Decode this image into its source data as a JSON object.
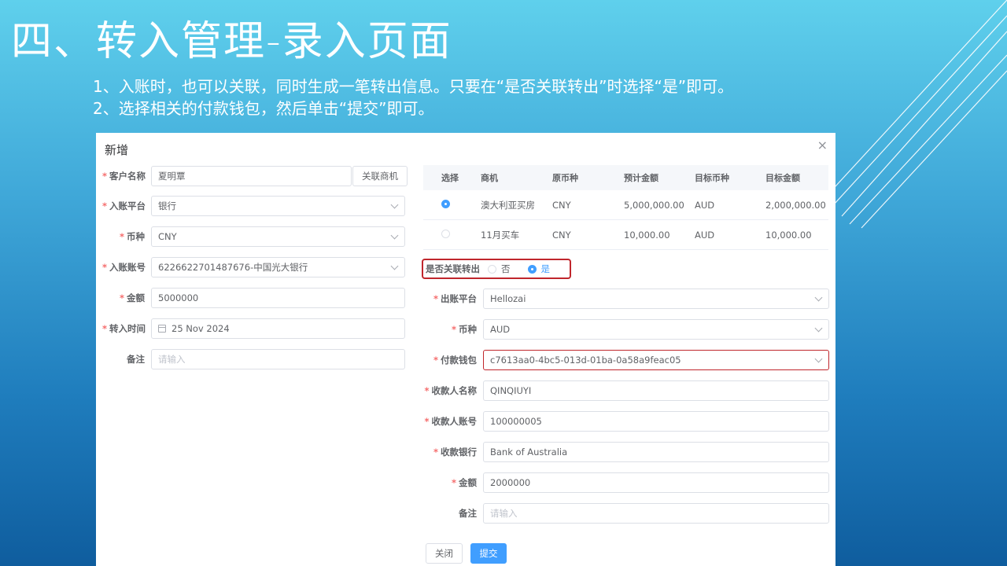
{
  "slide": {
    "title": "四、转入管理-录入页面",
    "bullets": [
      "1、入账时，也可以关联，同时生成一笔转出信息。只要在“是否关联转出”时选择“是”即可。",
      "2、选择相关的付款钱包，然后单击“提交”即可。"
    ]
  },
  "dialog": {
    "title": "新增",
    "close_icon": "×",
    "left_form": {
      "customer": {
        "label": "客户名称",
        "value": "夏明覃",
        "link_button": "关联商机"
      },
      "platform": {
        "label": "入账平台",
        "value": "银行"
      },
      "currency": {
        "label": "币种",
        "value": "CNY"
      },
      "account": {
        "label": "入账账号",
        "value": "6226622701487676-中国光大银行"
      },
      "amount": {
        "label": "金额",
        "value": "5000000"
      },
      "time": {
        "label": "转入时间",
        "value": "25 Nov 2024"
      },
      "remark": {
        "label": "备注",
        "placeholder": "请输入"
      }
    },
    "table": {
      "headers": [
        "选择",
        "商机",
        "原币种",
        "预计金额",
        "目标币种",
        "目标金额"
      ],
      "rows": [
        {
          "selected": true,
          "opportunity": "澳大利亚买房",
          "src_currency": "CNY",
          "est_amount": "5,000,000.00",
          "target_currency": "AUD",
          "target_amount": "2,000,000.00"
        },
        {
          "selected": false,
          "opportunity": "11月买车",
          "src_currency": "CNY",
          "est_amount": "10,000.00",
          "target_currency": "AUD",
          "target_amount": "10,000.00"
        }
      ]
    },
    "link_transfer": {
      "label": "是否关联转出",
      "option_no": "否",
      "option_yes": "是",
      "selected": "是"
    },
    "right_form": {
      "out_platform": {
        "label": "出账平台",
        "value": "Hellozai"
      },
      "currency": {
        "label": "币种",
        "value": "AUD"
      },
      "wallet": {
        "label": "付款钱包",
        "value": "c7613aa0-4bc5-013d-01ba-0a58a9feac05"
      },
      "payee_name": {
        "label": "收款人名称",
        "value": "QINQIUYI"
      },
      "payee_account": {
        "label": "收款人账号",
        "value": "100000005"
      },
      "bank": {
        "label": "收款银行",
        "value": "Bank of Australia"
      },
      "amount": {
        "label": "金额",
        "value": "2000000"
      },
      "remark": {
        "label": "备注",
        "placeholder": "请输入"
      }
    },
    "buttons": {
      "close": "关闭",
      "submit": "提交"
    }
  },
  "colors": {
    "primary": "#409eff",
    "highlight": "#c0262c",
    "required": "#f56c6c"
  }
}
